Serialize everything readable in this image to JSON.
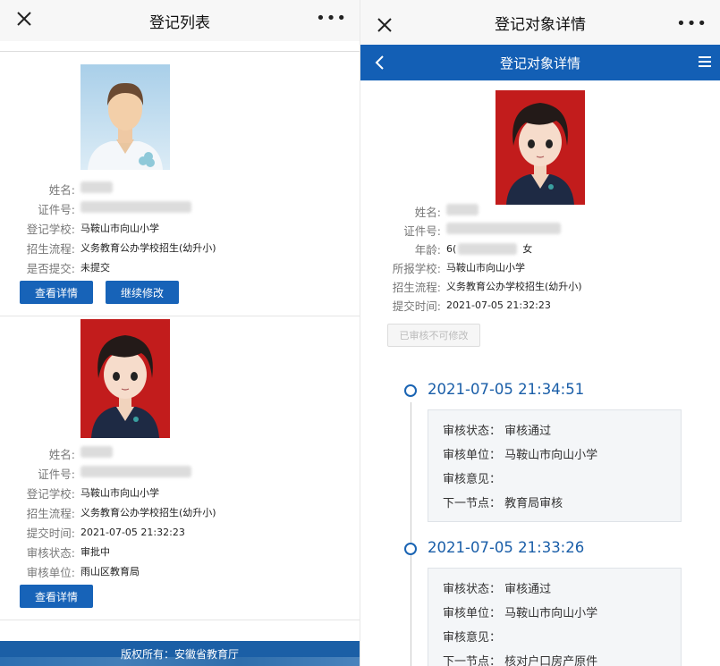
{
  "left": {
    "title": "登记列表",
    "more": "•••",
    "cards": [
      {
        "fields": [
          {
            "label": "姓名:",
            "value": ""
          },
          {
            "label": "证件号:",
            "value": ""
          },
          {
            "label": "登记学校:",
            "value": "马鞍山市向山小学"
          },
          {
            "label": "招生流程:",
            "value": "义务教育公办学校招生(幼升小)"
          },
          {
            "label": "是否提交:",
            "value": "未提交"
          }
        ],
        "buttons": [
          "查看详情",
          "继续修改"
        ]
      },
      {
        "fields": [
          {
            "label": "姓名:",
            "value": ""
          },
          {
            "label": "证件号:",
            "value": ""
          },
          {
            "label": "登记学校:",
            "value": "马鞍山市向山小学"
          },
          {
            "label": "招生流程:",
            "value": "义务教育公办学校招生(幼升小)"
          },
          {
            "label": "提交时间:",
            "value": "2021-07-05 21:32:23"
          },
          {
            "label": "审核状态:",
            "value": "审批中"
          },
          {
            "label": "审核单位:",
            "value": "雨山区教育局"
          }
        ],
        "buttons": [
          "查看详情"
        ]
      }
    ],
    "footer": "版权所有：安徽省教育厅"
  },
  "right": {
    "title": "登记对象详情",
    "more": "•••",
    "subheader": "登记对象详情",
    "fields": [
      {
        "label": "姓名:",
        "value": ""
      },
      {
        "label": "证件号:",
        "value": ""
      },
      {
        "label": "年龄:",
        "value": "6(",
        "extra": "女"
      },
      {
        "label": "所报学校:",
        "value": "马鞍山市向山小学"
      },
      {
        "label": "招生流程:",
        "value": "义务教育公办学校招生(幼升小)"
      },
      {
        "label": "提交时间:",
        "value": "2021-07-05 21:32:23"
      }
    ],
    "disabled_button": "已审核不可修改",
    "timeline": [
      {
        "time": "2021-07-05 21:34:51",
        "rows": [
          "审核状态：  审核通过",
          "审核单位：  马鞍山市向山小学",
          "审核意见：",
          "下一节点：  教育局审核"
        ]
      },
      {
        "time": "2021-07-05 21:33:26",
        "rows": [
          "审核状态：  审核通过",
          "审核单位：  马鞍山市向山小学",
          "审核意见：",
          "下一节点：  核对户口房产原件"
        ]
      }
    ]
  },
  "colors": {
    "primary": "#135fb5",
    "button": "#1763b8",
    "timeline": "#1a5ea8"
  }
}
